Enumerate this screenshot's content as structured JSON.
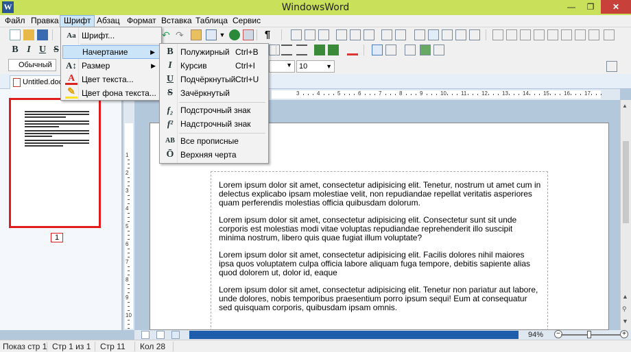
{
  "window": {
    "title": "WindowsWord",
    "app_icon": "W"
  },
  "window_controls": {
    "minimize": "—",
    "maximize": "❐",
    "close": "✕"
  },
  "menubar": {
    "items": [
      "Файл",
      "Правка",
      "Шрифт",
      "Абзац",
      "Формат",
      "Вставка",
      "Таблица",
      "Сервис"
    ],
    "active": "Шрифт"
  },
  "toolbar": {
    "style_value": "Обычный",
    "size_value": "10",
    "bold": "B",
    "italic": "I",
    "underline": "U",
    "strike": "S",
    "pilcrow": "¶"
  },
  "tab": {
    "label": "Untitled.docx"
  },
  "font_menu": {
    "items": [
      {
        "label": "Шрифт...",
        "icon": "font-dialog-icon"
      },
      {
        "label": "Начертание",
        "icon": "",
        "submenu": true
      },
      {
        "label": "Размер",
        "icon": "font-size-icon",
        "submenu": true
      },
      {
        "label": "Цвет текста...",
        "icon": "text-color-icon"
      },
      {
        "label": "Цвет фона текста...",
        "icon": "highlight-color-icon"
      }
    ]
  },
  "style_submenu": {
    "items": [
      {
        "label": "Полужирный",
        "shortcut": "Ctrl+B",
        "icon_glyph": "B"
      },
      {
        "label": "Курсив",
        "shortcut": "Ctrl+I",
        "icon_glyph": "I"
      },
      {
        "label": "Подчёркнутый",
        "shortcut": "Ctrl+U",
        "icon_glyph": "U"
      },
      {
        "label": "Зачёркнутый",
        "shortcut": "",
        "icon_glyph": "S"
      },
      {
        "label": "Подстрочный знак",
        "shortcut": "",
        "icon_glyph": "f₂"
      },
      {
        "label": "Надстрочный знак",
        "shortcut": "",
        "icon_glyph": "f²"
      },
      {
        "label": "Все прописные",
        "shortcut": "",
        "icon_glyph": "AB"
      },
      {
        "label": "Верхняя черта",
        "shortcut": "",
        "icon_glyph": "Ō"
      }
    ]
  },
  "thumbnail": {
    "page_number": "1"
  },
  "ruler": {
    "h_numbers": [
      "3",
      "4",
      "5",
      "6",
      "7",
      "8",
      "9",
      "10",
      "11",
      "12",
      "13",
      "14",
      "15",
      "16",
      "17"
    ],
    "v_numbers": [
      "1",
      "2",
      "3",
      "4",
      "5",
      "6",
      "7",
      "8",
      "9",
      "10",
      "11",
      "12",
      "13"
    ]
  },
  "document": {
    "paragraphs": [
      "Lorem ipsum dolor sit amet, consectetur adipisicing elit. Tenetur, nostrum ut amet cum in delectus explicabo ipsam molestiae velit, non repudiandae repellat veritatis asperiores quam perferendis molestias officia quibusdam dolorum.",
      "Lorem ipsum dolor sit amet, consectetur adipisicing elit. Consectetur sunt sit unde corporis est molestias modi vitae voluptas repudiandae reprehenderit illo suscipit minima nostrum, libero quis quae fugiat illum voluptate?",
      "Lorem ipsum dolor sit amet, consectetur adipisicing elit. Facilis dolores nihil maiores ipsa quos voluptatem culpa officia labore aliquam fuga tempore, debitis sapiente alias quod dolorem ut, dolor id, eaque",
      "Lorem ipsum dolor sit amet, consectetur adipisicing elit. Tenetur non pariatur aut labore, unde dolores, nobis temporibus praesentium porro ipsum sequi! Eum at consequatur sed quisquam corporis, quibusdam ipsam omnis."
    ]
  },
  "zoom": {
    "value": "94%",
    "minus": "−",
    "plus": "+"
  },
  "statusbar": {
    "show_page": "Показ стр 1",
    "page_of": "Стр 1 из 1",
    "line": "Стр 11",
    "column": "Кол 28"
  },
  "colors": {
    "titlebar": "#c8e05a",
    "close": "#c7403a",
    "highlight": "#cce4f7",
    "thumb_border": "#e21c1c",
    "hscroll": "#1e5dab"
  }
}
